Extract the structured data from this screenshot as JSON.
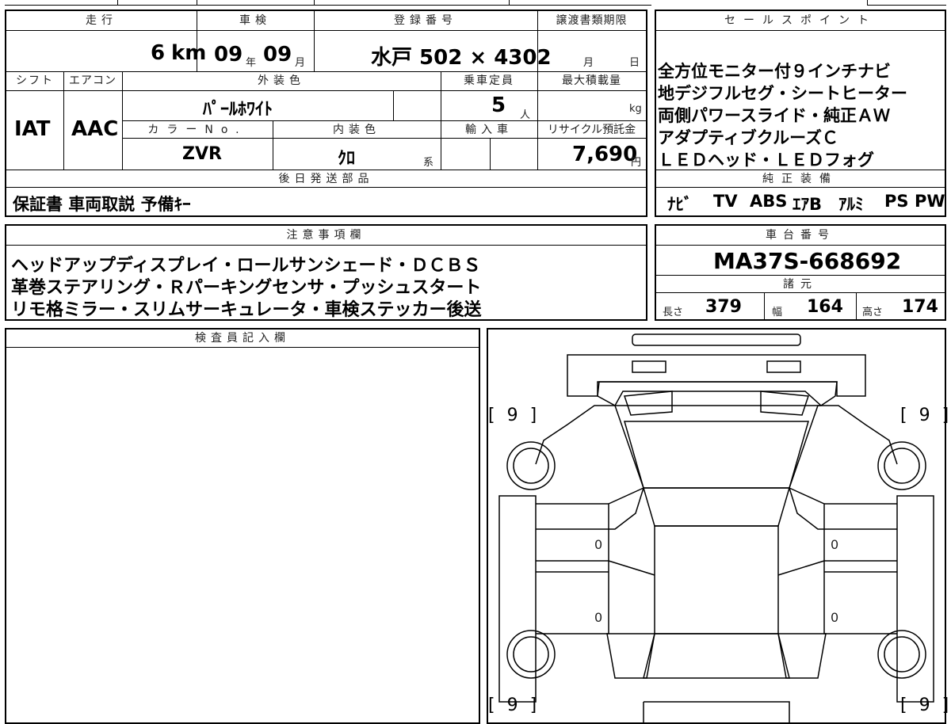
{
  "top": {
    "mileage": {
      "label": "走行",
      "value": "6",
      "unit": "km"
    },
    "inspection": {
      "label": "車検",
      "year": "09",
      "year_unit": "年",
      "month": "09",
      "month_unit": "月"
    },
    "registration": {
      "label": "登録番号",
      "value": "水戸 502 × 4302"
    },
    "transfer_deadline": {
      "label": "譲渡書類期限",
      "month_unit": "月",
      "day_unit": "日"
    },
    "shift": {
      "label": "シフト",
      "value": "IAT"
    },
    "aircon": {
      "label": "エアコン",
      "value": "AAC"
    },
    "exterior_color": {
      "label": "外装色",
      "value": "ﾊﾟｰﾙﾎﾜｲﾄ"
    },
    "capacity": {
      "label": "乗車定員",
      "value": "5",
      "unit": "人"
    },
    "max_load": {
      "label": "最大積載量",
      "unit": "kg"
    },
    "color_no": {
      "label": "カラーNo.",
      "value": "ZVR"
    },
    "interior_color": {
      "label": "内装色",
      "value": "ｸﾛ",
      "unit": "系"
    },
    "import": {
      "label": "輸入車"
    },
    "recycle": {
      "label": "リサイクル預託金",
      "value": "7,690",
      "unit": "円"
    }
  },
  "later_parts": {
    "label": "後日発送部品",
    "value": "保証書 車両取説 予備ｷｰ"
  },
  "sales_points": {
    "label": "セールスポイント",
    "lines": [
      "全方位モニター付９インチナビ",
      "地デジフルセグ・シートヒーター",
      "両側パワースライド・純正ＡＷ",
      "アダプティブクルーズＣ",
      "ＬＥＤヘッド・ＬＥＤフォグ"
    ]
  },
  "genuine_equipment": {
    "label": "純正装備",
    "items": [
      "ﾅﾋﾞ",
      "TV",
      "ABS",
      "ｴｱB",
      "ｱﾙﾐ",
      "PS",
      "PW"
    ]
  },
  "notes": {
    "label": "注意事項欄",
    "lines": [
      "ヘッドアップディスプレイ・ロールサンシェード・ＤＣＢＳ",
      "革巻ステアリング・Ｒパーキングセンサ・プッシュスタート",
      "リモ格ミラー・スリムサーキュレータ・車検ステッカー後送"
    ]
  },
  "chassis": {
    "label": "車台番号",
    "value": "MA37S-668692"
  },
  "specs": {
    "label": "諸元",
    "length_label": "長さ",
    "length": "379",
    "width_label": "幅",
    "width": "164",
    "height_label": "高さ",
    "height": "174"
  },
  "inspector": {
    "label": "検査員記入欄"
  },
  "diagram": {
    "tire_fl": "[ 9 ]",
    "tire_fr": "[ 9 ]",
    "tire_rl": "[ 9 ]",
    "tire_rr": "[ 9 ]",
    "door_fl": "0",
    "door_fr": "0",
    "door_rl": "0",
    "door_rr": "0"
  }
}
